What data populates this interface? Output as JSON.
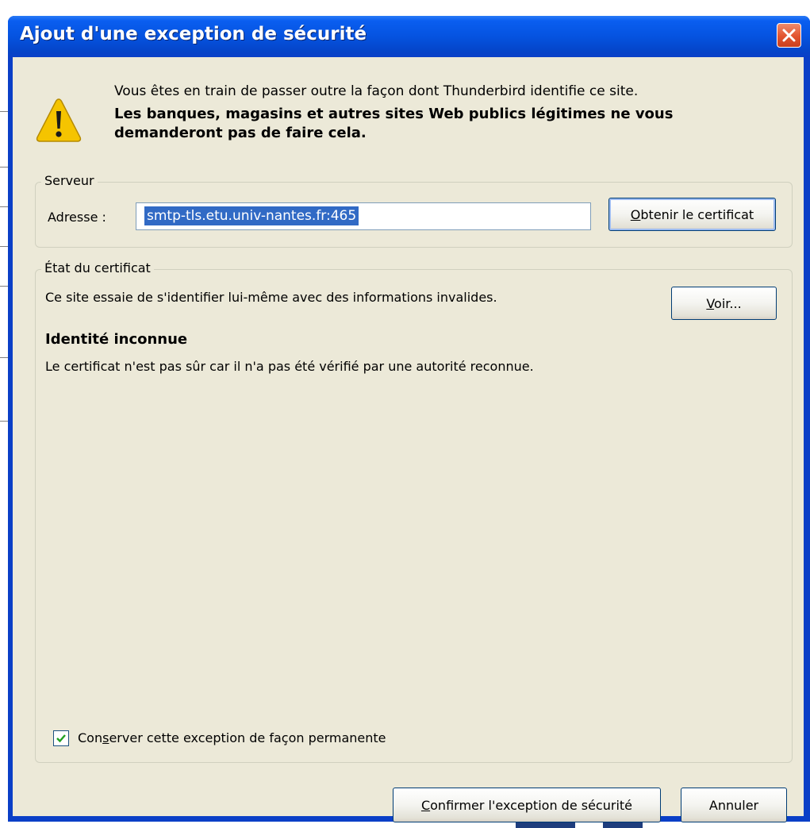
{
  "dialog": {
    "title": "Ajout d'une exception de sécurité",
    "intro": "Vous êtes en train de passer outre la façon dont Thunderbird identifie ce site.",
    "warning_bold": "Les banques, magasins et autres sites Web publics légitimes ne vous demanderont pas de faire cela."
  },
  "server_group": {
    "legend": "Serveur",
    "address_label": "Adresse :",
    "address_value": "smtp-tls.etu.univ-nantes.fr:465",
    "get_cert_button": {
      "accel": "O",
      "rest": "btenir le certificat"
    }
  },
  "cert_status_group": {
    "legend": "État du certificat",
    "status_text": "Ce site essaie de s'identifier lui-même avec des informations invalides.",
    "view_button": {
      "accel": "V",
      "rest": "oir..."
    },
    "identity_heading": "Identité inconnue",
    "identity_detail": "Le certificat n'est pas sûr car il n'a pas été vérifié par une autorité reconnue.",
    "permanent_checkbox": {
      "checked": true,
      "pre": "Con",
      "accel": "s",
      "post": "erver cette exception de façon permanente"
    }
  },
  "buttons": {
    "confirm": {
      "accel": "C",
      "rest": "onfirmer l'exception de sécurité"
    },
    "cancel": "Annuler"
  },
  "colors": {
    "titlebar": "#0553e0",
    "dialog_bg": "#ece9d8",
    "selection": "#316ac5",
    "close_button": "#e2542f",
    "warning_yellow": "#f5c400"
  },
  "icons": {
    "title_close": "close-icon",
    "warning": "warning-icon",
    "checkbox": "checkmark-icon"
  }
}
